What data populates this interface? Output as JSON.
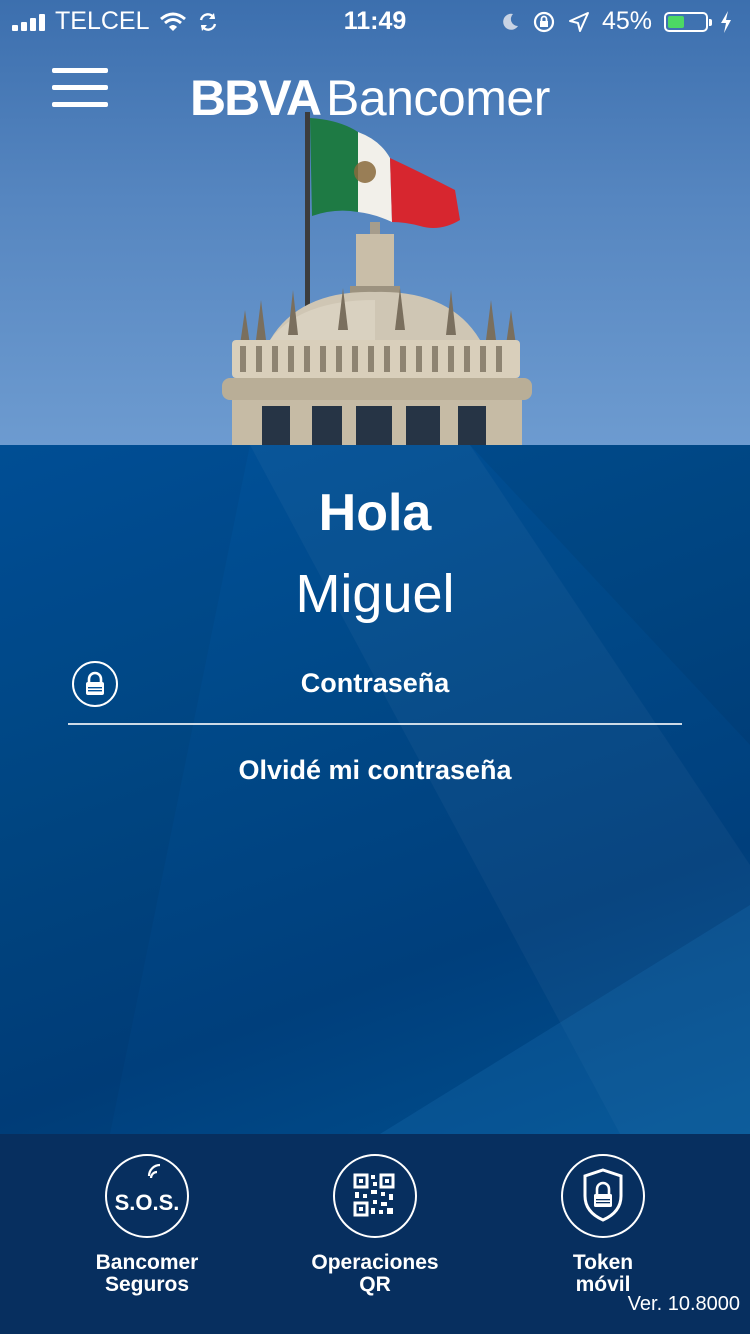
{
  "status_bar": {
    "carrier": "TELCEL",
    "time": "11:49",
    "battery_percent": "45%",
    "battery_level": 0.45,
    "battery_color": "#4cd964"
  },
  "header": {
    "menu_icon": "hamburger-menu-icon",
    "logo_bold": "BBVA",
    "logo_rest": "Bancomer"
  },
  "login": {
    "greeting": "Hola",
    "user_name": "Miguel",
    "password_placeholder": "Contraseña",
    "password_icon": "lock-icon",
    "forgot_password": "Olvidé mi contraseña"
  },
  "footer": {
    "buttons": [
      {
        "line1": "Bancomer",
        "line2": "Seguros",
        "icon": "sos-icon"
      },
      {
        "line1": "Operaciones",
        "line2": "QR",
        "icon": "qr-code-icon"
      },
      {
        "line1": "Token",
        "line2": "móvil",
        "icon": "shield-lock-icon"
      }
    ],
    "version": "Ver. 10.8000"
  },
  "colors": {
    "brand_blue": "#004481",
    "footer_navy": "#072f5f",
    "sky": "#5686c0"
  }
}
